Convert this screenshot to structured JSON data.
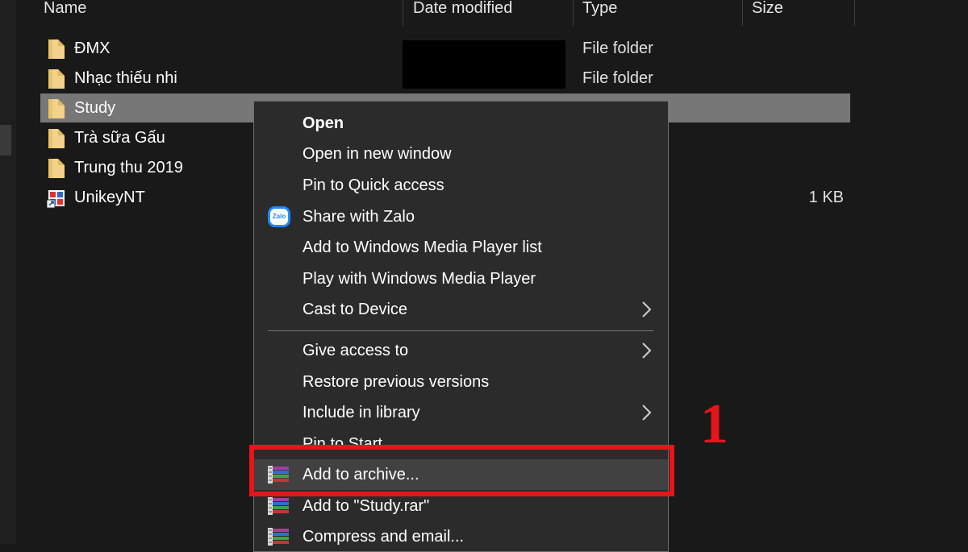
{
  "columns": {
    "name": "Name",
    "date_modified": "Date modified",
    "type": "Type",
    "size": "Size"
  },
  "files": [
    {
      "name": "ĐMX",
      "type": "File folder",
      "size": "",
      "icon": "folder-icon"
    },
    {
      "name": "Nhạc thiếu nhi",
      "type": "File folder",
      "size": "",
      "icon": "folder-icon"
    },
    {
      "name": "Study",
      "type": "",
      "size": "",
      "icon": "folder-icon",
      "selected": true
    },
    {
      "name": "Trà sữa Gấu",
      "type": "",
      "size": "",
      "icon": "folder-icon"
    },
    {
      "name": "Trung thu 2019",
      "type": "",
      "size": "",
      "icon": "folder-icon"
    },
    {
      "name": "UnikeyNT",
      "type": "",
      "size": "1 KB",
      "icon": "unikey-shortcut-icon"
    }
  ],
  "context_menu": {
    "items": [
      {
        "label": "Open",
        "bold": true
      },
      {
        "label": "Open in new window"
      },
      {
        "label": "Pin to Quick access"
      },
      {
        "label": "Share with Zalo",
        "icon": "zalo-icon"
      },
      {
        "label": "Add to Windows Media Player list"
      },
      {
        "label": "Play with Windows Media Player"
      },
      {
        "label": "Cast to Device",
        "submenu": true
      },
      {
        "label": "Give access to",
        "submenu": true
      },
      {
        "label": "Restore previous versions"
      },
      {
        "label": "Include in library",
        "submenu": true
      },
      {
        "label": "Pin to Start"
      },
      {
        "label": "Add to archive...",
        "icon": "winrar-icon",
        "highlighted": true
      },
      {
        "label": "Add to \"Study.rar\"",
        "icon": "winrar-icon"
      },
      {
        "label": "Compress and email...",
        "icon": "winrar-icon"
      }
    ]
  },
  "annotation": {
    "step_number": "1",
    "color": "#e8141b"
  },
  "colors": {
    "background": "#191919",
    "menu_background": "#2b2b2b",
    "selected_row": "#777777",
    "menu_hover": "#414141"
  }
}
